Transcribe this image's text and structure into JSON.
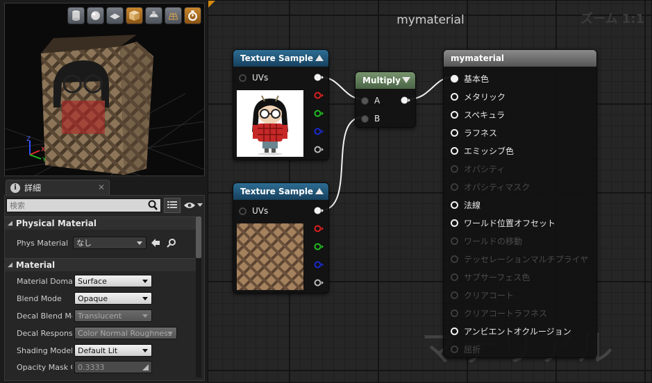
{
  "viewport": {
    "toolbar": [
      {
        "icon": "cylinder-icon",
        "active": false
      },
      {
        "icon": "sphere-icon",
        "active": false
      },
      {
        "icon": "plane-icon",
        "active": false
      },
      {
        "icon": "cube-icon",
        "active": true
      },
      {
        "icon": "custom-mesh-icon",
        "active": false
      },
      {
        "icon": "grid-toggle-icon",
        "active": false
      },
      {
        "icon": "realtime-icon",
        "active": true
      }
    ],
    "axis": {
      "z": "Z",
      "x": "X",
      "y": "Y"
    }
  },
  "details": {
    "tab_label": "詳細",
    "tab_close": "✕",
    "search_placeholder": "検索",
    "categories": [
      {
        "label": "Physical Material",
        "rows": [
          {
            "label": "Phys Material",
            "value": "なし"
          }
        ]
      },
      {
        "label": "Material",
        "rows": [
          {
            "label": "Material Domain",
            "value": "Surface",
            "enabled": true
          },
          {
            "label": "Blend Mode",
            "value": "Opaque",
            "enabled": true
          },
          {
            "label": "Decal Blend Mode",
            "value": "Translucent",
            "enabled": false
          },
          {
            "label": "Decal Response",
            "value": "Color Normal Roughness",
            "enabled": false
          },
          {
            "label": "Shading Model",
            "value": "Default Lit",
            "enabled": true
          },
          {
            "label": "Opacity Mask Clip Value",
            "value": "0.3333",
            "enabled": false
          }
        ]
      }
    ]
  },
  "graph": {
    "title": "mymaterial",
    "zoom": "ズーム 1:1",
    "watermark": "マテリアル",
    "nodes": {
      "texture_sample_1": {
        "title": "Texture Sample",
        "input": "UVs"
      },
      "texture_sample_2": {
        "title": "Texture Sample",
        "input": "UVs"
      },
      "multiply": {
        "title": "Multiply",
        "inputs": [
          "A",
          "B"
        ]
      },
      "result": {
        "title": "mymaterial",
        "inputs": [
          {
            "label": "基本色",
            "enabled": true,
            "connected": true
          },
          {
            "label": "メタリック",
            "enabled": true,
            "connected": false
          },
          {
            "label": "スペキュラ",
            "enabled": true,
            "connected": false
          },
          {
            "label": "ラフネス",
            "enabled": true,
            "connected": false
          },
          {
            "label": "エミッシブ色",
            "enabled": true,
            "connected": false
          },
          {
            "label": "オパシティ",
            "enabled": false,
            "connected": false
          },
          {
            "label": "オパシティマスク",
            "enabled": false,
            "connected": false
          },
          {
            "label": "法線",
            "enabled": true,
            "connected": false
          },
          {
            "label": "ワールド位置オフセット",
            "enabled": true,
            "connected": false
          },
          {
            "label": "ワールドの移動",
            "enabled": false,
            "connected": false
          },
          {
            "label": "テッセレーションマルチプライヤ",
            "enabled": false,
            "connected": false
          },
          {
            "label": "サブサーフェス色",
            "enabled": false,
            "connected": false
          },
          {
            "label": "クリアコート",
            "enabled": false,
            "connected": false
          },
          {
            "label": "クリアコートラフネス",
            "enabled": false,
            "connected": false
          },
          {
            "label": "アンビエントオクルージョン",
            "enabled": true,
            "connected": false
          },
          {
            "label": "屈折",
            "enabled": false,
            "connected": false
          }
        ]
      }
    },
    "pin_colors": {
      "white": "#f2f2f2",
      "red": "#e02020",
      "green": "#20c020",
      "blue": "#1a2ad0",
      "alpha": "#bbbbbb"
    }
  }
}
